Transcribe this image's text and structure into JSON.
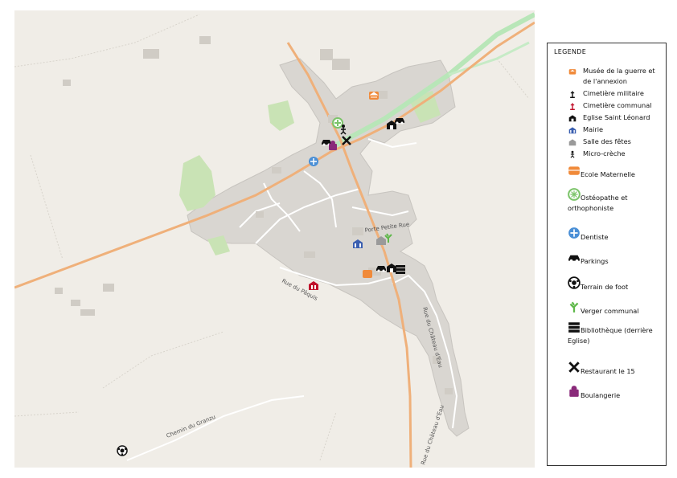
{
  "legend": {
    "title": "LEGENDE",
    "small_items": [
      {
        "icon": "museum-icon",
        "color": "#f08a3a",
        "label_lines": [
          "Musée de la guerre et",
          "de l'annexion"
        ]
      },
      {
        "icon": "cross-icon",
        "color": "#111111",
        "label_lines": [
          "Cimetière militaire"
        ]
      },
      {
        "icon": "cross-icon",
        "color": "#c0102a",
        "label_lines": [
          "Cimetière communal"
        ]
      },
      {
        "icon": "church-icon",
        "color": "#111111",
        "label_lines": [
          "Eglise Saint Léonard"
        ]
      },
      {
        "icon": "townhall-icon",
        "color": "#3b5fb0",
        "label_lines": [
          "Mairie"
        ]
      },
      {
        "icon": "hall-icon",
        "color": "#9a9a9a",
        "label_lines": [
          "Salle des fêtes"
        ]
      },
      {
        "icon": "child-icon",
        "color": "#111111",
        "label_lines": [
          "Micro-crèche"
        ]
      }
    ],
    "big_items": [
      {
        "icon": "school-icon",
        "color": "#f08a3a",
        "label_lines": [
          "Ecole Maternelle"
        ]
      },
      {
        "icon": "health-icon",
        "color": "#7cc46a",
        "label_lines": [
          "Ostéopathe et",
          "orthophoniste"
        ]
      },
      {
        "icon": "dentist-icon",
        "color": "#4a8fd6",
        "label_lines": [
          "Dentiste"
        ]
      },
      {
        "icon": "car-icon",
        "color": "#111111",
        "label_lines": [
          "Parkings"
        ]
      },
      {
        "icon": "football-icon",
        "color": "#111111",
        "label_lines": [
          "Terrain de foot"
        ]
      },
      {
        "icon": "tree-icon",
        "color": "#5fb84a",
        "label_lines": [
          "Verger communal"
        ]
      },
      {
        "icon": "books-icon",
        "color": "#111111",
        "label_lines": [
          "Bibliothèque (derrière",
          "Eglise)"
        ]
      },
      {
        "icon": "restaurant-icon",
        "color": "#111111",
        "label_lines": [
          "Restaurant le 15"
        ]
      },
      {
        "icon": "bakery-icon",
        "color": "#8a2a7a",
        "label_lines": [
          "Boulangerie"
        ]
      }
    ]
  },
  "map": {
    "streets": {
      "porte_petite_rue": "Porte Petite Rue",
      "rue_du_paquis": "Rue du Pâquis",
      "rue_du_chateau_deau": "Rue du Château d'Eau",
      "rue_du_chateau_deau_2": "Rue du Château d'Eau",
      "chemin_du_granzu": "Chemin du Granzu"
    },
    "colors": {
      "background": "#f0ede7",
      "builtup": "#d9d6d1",
      "main_road": "#efb07a",
      "rail": "#b8e6b8",
      "greens": "#c9e3b5"
    }
  }
}
